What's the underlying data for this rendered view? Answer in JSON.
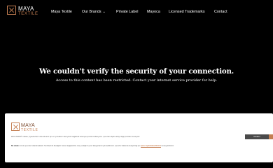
{
  "brand": {
    "name": "MAYA",
    "sub": "TEXTILE"
  },
  "nav": {
    "items": [
      "Maya Textile",
      "Our Brands",
      "Private Label",
      "Mayoca",
      "Licensed Trademarks",
      "Contact"
    ],
    "dropdown_icon": "chevron-down-icon"
  },
  "error": {
    "title": "We couldn't verify the security of your connection.",
    "message": "Access to this content has been restricted. Contact your internet service provider for help."
  },
  "cookie": {
    "text1": "MAYA TEKSTİL olarak, ziyaretleriniz sırasında sizin için en iyi kullanım deneyimini sağlamak amacıyla çerezler kullanıyoruz. Çerezlere ilişkin detaylı bilgi için lütfen inceleyiniz.",
    "text2_bold": "Bu sitede",
    "text2": " zorunlu çerezler kullanılmaktadır. Tercihlerinizi dilediğiniz zaman değiştirebilir, onay verdiğiniz çerez kategorilerini yönetebilirsiniz. Çerezler hakkında detaylı bilgi için ",
    "link": "Çerez Aydınlatma Metnini",
    "text2_end": " inceleyebilirsiniz.",
    "reject_label": "Reddet",
    "colors": {
      "accent": "#c47e52",
      "button_dark": "#4a4a4a"
    }
  }
}
